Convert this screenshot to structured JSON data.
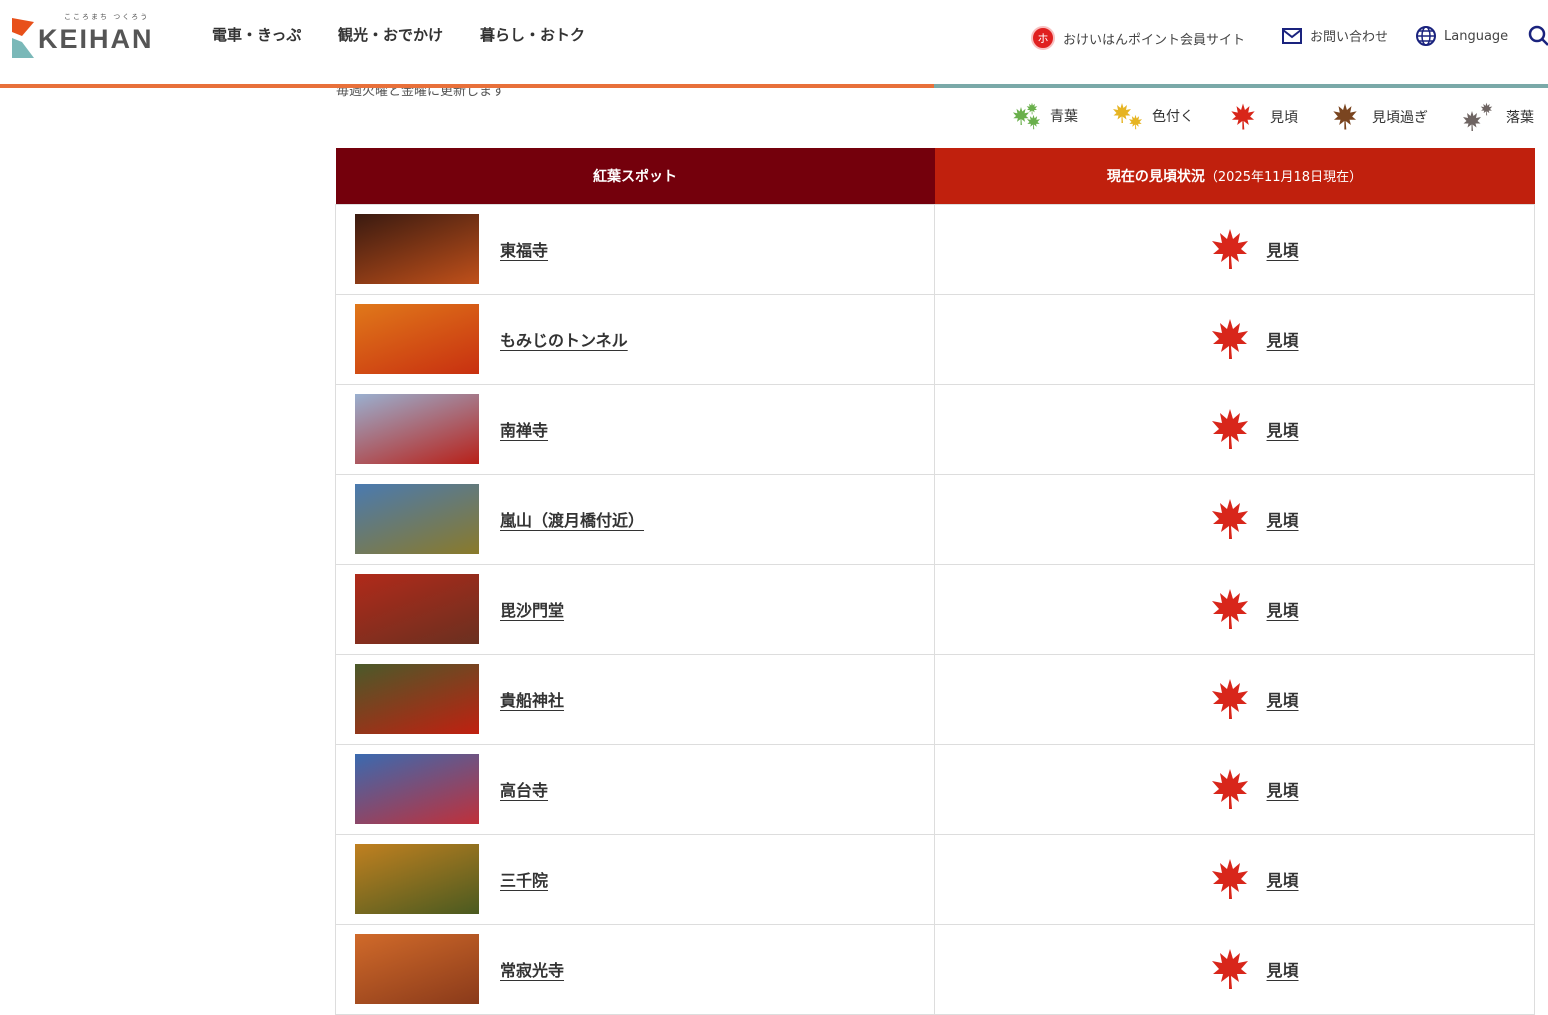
{
  "header": {
    "logo_tagline": "こころまち つくろう",
    "logo_text": "KEIHAN",
    "nav": [
      "電車・きっぷ",
      "観光・おでかけ",
      "暮らし・おトク"
    ],
    "utility": {
      "points": "おけいはんポイント会員サイト",
      "contact": "お問い合わせ",
      "language": "Language"
    }
  },
  "notice": "毎週火曜と金曜に更新します",
  "legend": [
    {
      "label": "青葉",
      "color": "#6ab04c"
    },
    {
      "label": "色付く",
      "color": "#e6b422"
    },
    {
      "label": "見頃",
      "color": "#d8261a"
    },
    {
      "label": "見頃過ぎ",
      "color": "#7a4520"
    },
    {
      "label": "落葉",
      "color": "#6e6462"
    }
  ],
  "table": {
    "col_spot": "紅葉スポット",
    "col_status": "現在の見頃状況",
    "col_status_date": "（2025年11月18日現在）",
    "rows": [
      {
        "name": "東福寺",
        "status": "見頃",
        "thumb": [
          "#3a1a10",
          "#c0501a"
        ]
      },
      {
        "name": "もみじのトンネル",
        "status": "見頃",
        "thumb": [
          "#e0781a",
          "#c83010"
        ]
      },
      {
        "name": "南禅寺",
        "status": "見頃",
        "thumb": [
          "#9ab0d0",
          "#b82018"
        ]
      },
      {
        "name": "嵐山（渡月橋付近）",
        "status": "見頃",
        "thumb": [
          "#4a7ab0",
          "#8a7a2a"
        ]
      },
      {
        "name": "毘沙門堂",
        "status": "見頃",
        "thumb": [
          "#b02a1a",
          "#6a3020"
        ]
      },
      {
        "name": "貴船神社",
        "status": "見頃",
        "thumb": [
          "#4a5a2a",
          "#c02010"
        ]
      },
      {
        "name": "高台寺",
        "status": "見頃",
        "thumb": [
          "#3a6ab0",
          "#c0303a"
        ]
      },
      {
        "name": "三千院",
        "status": "見頃",
        "thumb": [
          "#c08020",
          "#4a5a20"
        ]
      },
      {
        "name": "常寂光寺",
        "status": "見頃",
        "thumb": [
          "#d06a2a",
          "#8a3a1a"
        ]
      }
    ]
  },
  "colors": {
    "accent_orange": "#e8703a",
    "accent_teal": "#7aa9a8",
    "leaf_red": "#d8261a"
  }
}
